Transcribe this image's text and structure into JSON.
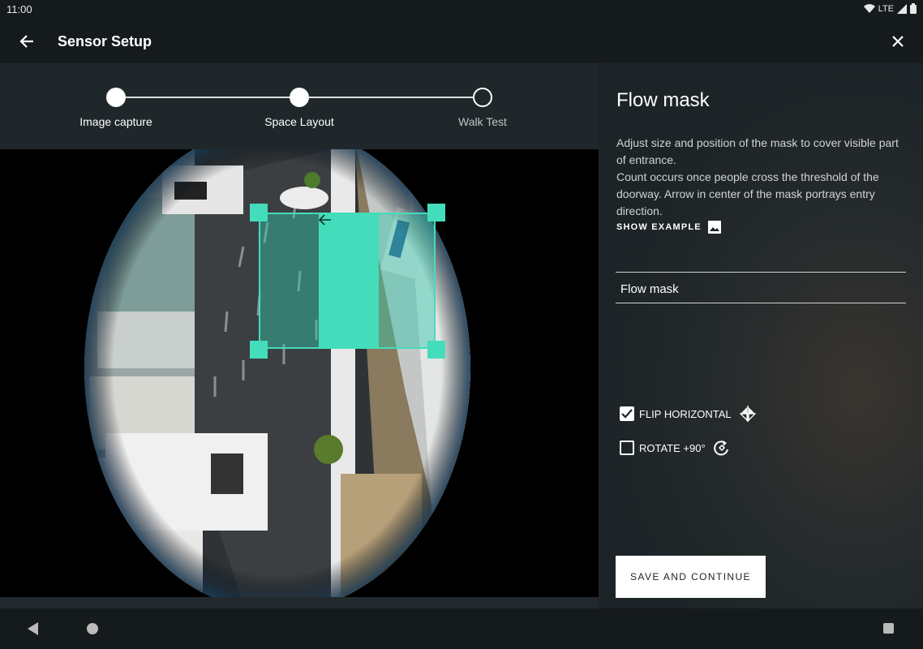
{
  "status_bar": {
    "time": "11:00",
    "network": "LTE",
    "icons": [
      "wifi-icon",
      "signal-icon",
      "battery-icon"
    ]
  },
  "app_bar": {
    "title": "Sensor Setup",
    "back_icon": "arrow-back-icon",
    "close_icon": "close-icon"
  },
  "stepper": {
    "steps": [
      {
        "label": "Image capture",
        "state": "done"
      },
      {
        "label": "Space Layout",
        "state": "current"
      },
      {
        "label": "Walk Test",
        "state": "todo"
      }
    ]
  },
  "mask": {
    "direction_icon": "arrow-left-icon",
    "color": "#44ddbb"
  },
  "panel": {
    "title": "Flow mask",
    "description_line1": "Adjust size and position of the mask to cover visible part of entrance.",
    "description_line2": "Count occurs once people cross the threshold of the doorway. Arrow in center of the mask portrays entry direction.",
    "show_example_label": "SHOW EXAMPLE",
    "show_example_icon": "image-icon",
    "field_value": "Flow mask",
    "flip_label": "FLIP HORIZONTAL",
    "flip_checked": true,
    "flip_icon": "flip-icon",
    "rotate_label": "ROTATE +90°",
    "rotate_checked": false,
    "rotate_icon": "rotate-icon",
    "save_label": "SAVE AND CONTINUE"
  },
  "nav_bar": {
    "back_icon": "nav-back-icon",
    "home_icon": "nav-home-icon",
    "recent_icon": "nav-recent-icon"
  }
}
